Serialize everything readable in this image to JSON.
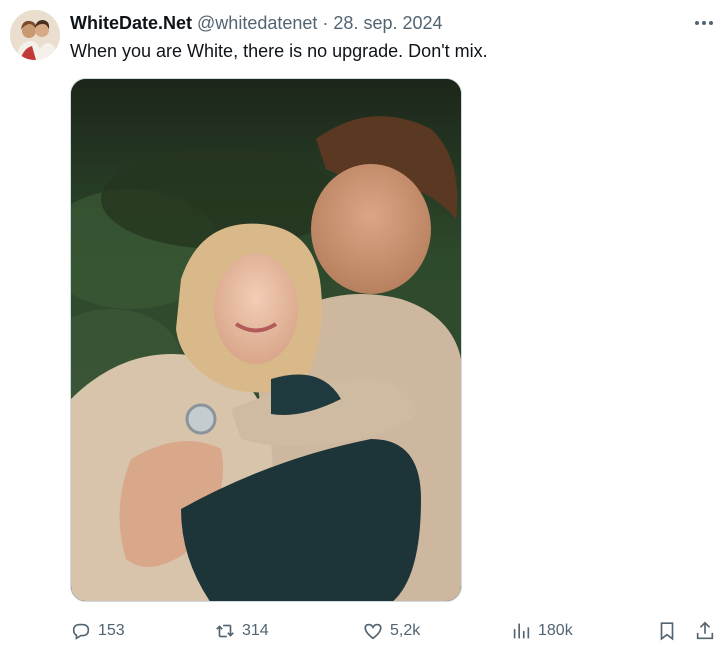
{
  "tweet": {
    "display_name": "WhiteDate.Net",
    "handle": "@whitedatenet",
    "separator": "·",
    "date": "28. sep. 2024",
    "text": "When you are White, there is no upgrade. Don't mix.",
    "media": {
      "kind": "photo"
    },
    "actions": {
      "reply": {
        "icon": "reply-icon",
        "count": "153"
      },
      "retweet": {
        "icon": "retweet-icon",
        "count": "314"
      },
      "like": {
        "icon": "heart-icon",
        "count": "5,2k"
      },
      "views": {
        "icon": "views-icon",
        "count": "180k"
      },
      "bookmark": {
        "icon": "bookmark-icon"
      },
      "share": {
        "icon": "share-icon"
      }
    }
  },
  "colors": {
    "text_primary": "#0f1419",
    "text_secondary": "#536471",
    "border": "#cfd9de"
  }
}
